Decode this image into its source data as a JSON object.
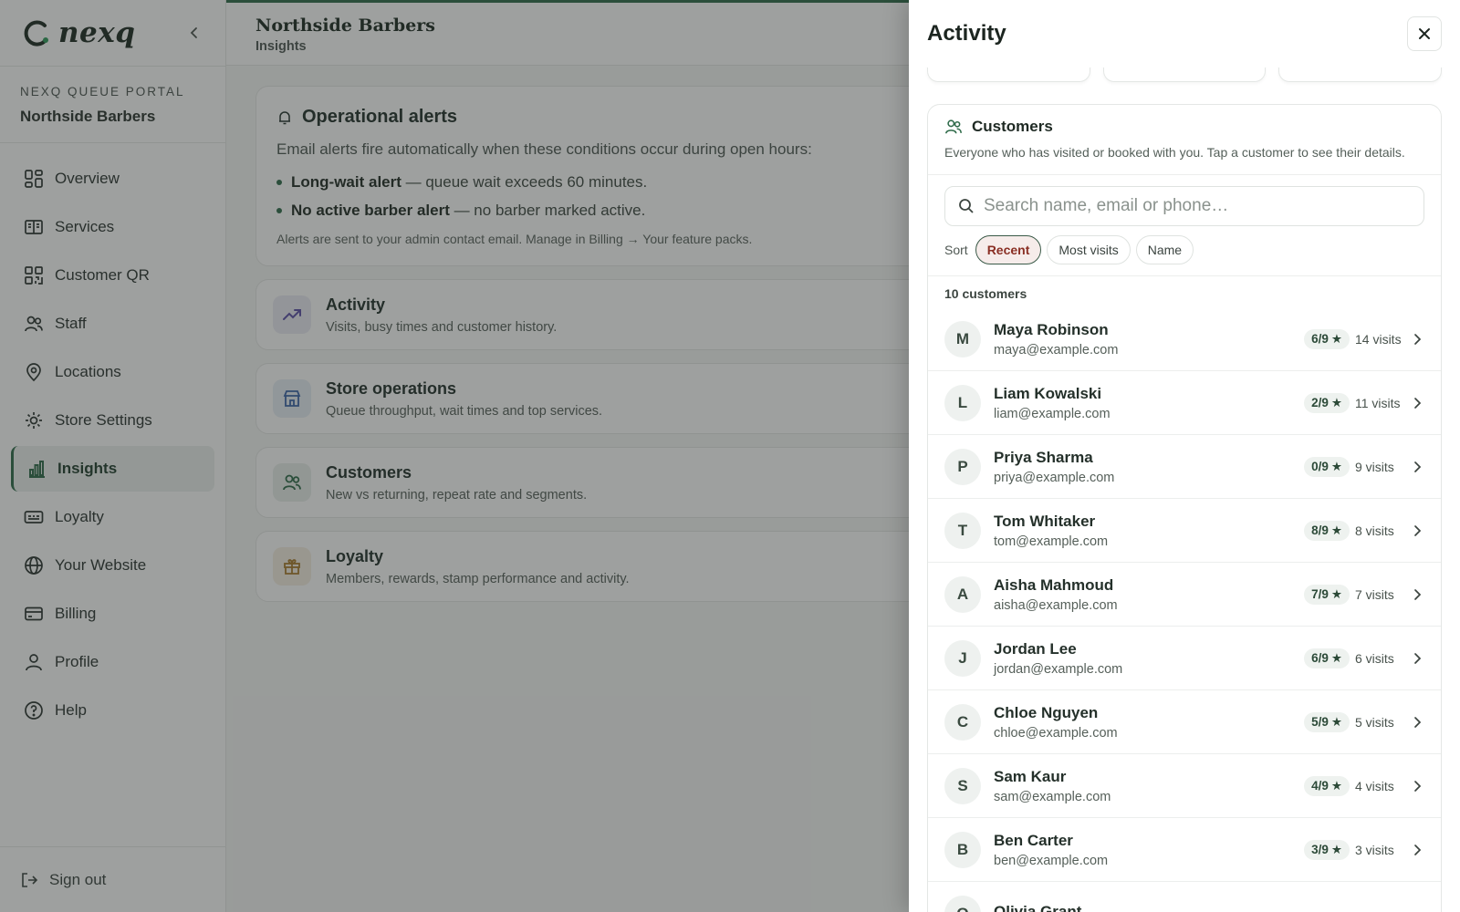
{
  "brand": {
    "name": "nexq"
  },
  "portal": {
    "kicker": "NEXQ QUEUE PORTAL",
    "store": "Northside Barbers"
  },
  "nav": [
    {
      "label": "Overview",
      "icon": "overview-icon"
    },
    {
      "label": "Services",
      "icon": "services-icon"
    },
    {
      "label": "Customer QR",
      "icon": "qr-icon"
    },
    {
      "label": "Staff",
      "icon": "staff-icon"
    },
    {
      "label": "Locations",
      "icon": "location-pin-icon"
    },
    {
      "label": "Store Settings",
      "icon": "gear-icon"
    },
    {
      "label": "Insights",
      "icon": "bar-chart-icon",
      "active": true
    },
    {
      "label": "Loyalty",
      "icon": "loyalty-card-icon"
    },
    {
      "label": "Your Website",
      "icon": "globe-icon"
    },
    {
      "label": "Billing",
      "icon": "credit-card-icon"
    },
    {
      "label": "Profile",
      "icon": "user-icon"
    },
    {
      "label": "Help",
      "icon": "help-icon"
    }
  ],
  "signout": "Sign out",
  "header": {
    "title": "Northside Barbers",
    "breadcrumb": "Insights"
  },
  "alerts": {
    "title": "Operational alerts",
    "intro": "Email alerts fire automatically when these conditions occur during open hours:",
    "items": [
      {
        "bold": "Long-wait alert",
        "rest": " — queue wait exceeds 60 minutes."
      },
      {
        "bold": "No active barber alert",
        "rest": " — no barber marked active."
      }
    ],
    "note": "Alerts are sent to your admin contact email. Manage in Billing → Your feature packs."
  },
  "features": [
    {
      "title": "Activity",
      "subtitle": "Visits, busy times and customer history.",
      "icon": "trending-up-icon"
    },
    {
      "title": "Store operations",
      "subtitle": "Queue throughput, wait times and top services.",
      "icon": "store-icon"
    },
    {
      "title": "Customers",
      "subtitle": "New vs returning, repeat rate and segments.",
      "icon": "customers-icon"
    },
    {
      "title": "Loyalty",
      "subtitle": "Members, rewards, stamp performance and activity.",
      "icon": "gift-icon"
    }
  ],
  "drawer": {
    "title": "Activity",
    "section": {
      "title": "Customers",
      "subtitle": "Everyone who has visited or booked with you. Tap a customer to see their details."
    },
    "search": {
      "placeholder": "Search name, email or phone…",
      "value": ""
    },
    "sort": {
      "label": "Sort",
      "options": [
        "Recent",
        "Most visits",
        "Name"
      ],
      "selected": "Recent"
    },
    "count": "10 customers",
    "customers": [
      {
        "initial": "M",
        "name": "Maya Robinson",
        "email": "maya@example.com",
        "stamps": "6/9",
        "visits": "14 visits"
      },
      {
        "initial": "L",
        "name": "Liam Kowalski",
        "email": "liam@example.com",
        "stamps": "2/9",
        "visits": "11 visits"
      },
      {
        "initial": "P",
        "name": "Priya Sharma",
        "email": "priya@example.com",
        "stamps": "0/9",
        "visits": "9 visits"
      },
      {
        "initial": "T",
        "name": "Tom Whitaker",
        "email": "tom@example.com",
        "stamps": "8/9",
        "visits": "8 visits"
      },
      {
        "initial": "A",
        "name": "Aisha Mahmoud",
        "email": "aisha@example.com",
        "stamps": "7/9",
        "visits": "7 visits"
      },
      {
        "initial": "J",
        "name": "Jordan Lee",
        "email": "jordan@example.com",
        "stamps": "6/9",
        "visits": "6 visits"
      },
      {
        "initial": "C",
        "name": "Chloe Nguyen",
        "email": "chloe@example.com",
        "stamps": "5/9",
        "visits": "5 visits"
      },
      {
        "initial": "S",
        "name": "Sam Kaur",
        "email": "sam@example.com",
        "stamps": "4/9",
        "visits": "4 visits"
      },
      {
        "initial": "B",
        "name": "Ben Carter",
        "email": "ben@example.com",
        "stamps": "3/9",
        "visits": "3 visits"
      },
      {
        "initial": "O",
        "name": "Olivia Grant",
        "email": "",
        "stamps": "",
        "visits": ""
      }
    ]
  },
  "colors": {
    "brand": "#2f6b4a",
    "chip_active_text": "#8a2f24",
    "overlay": "rgba(40,44,42,0.45)"
  }
}
